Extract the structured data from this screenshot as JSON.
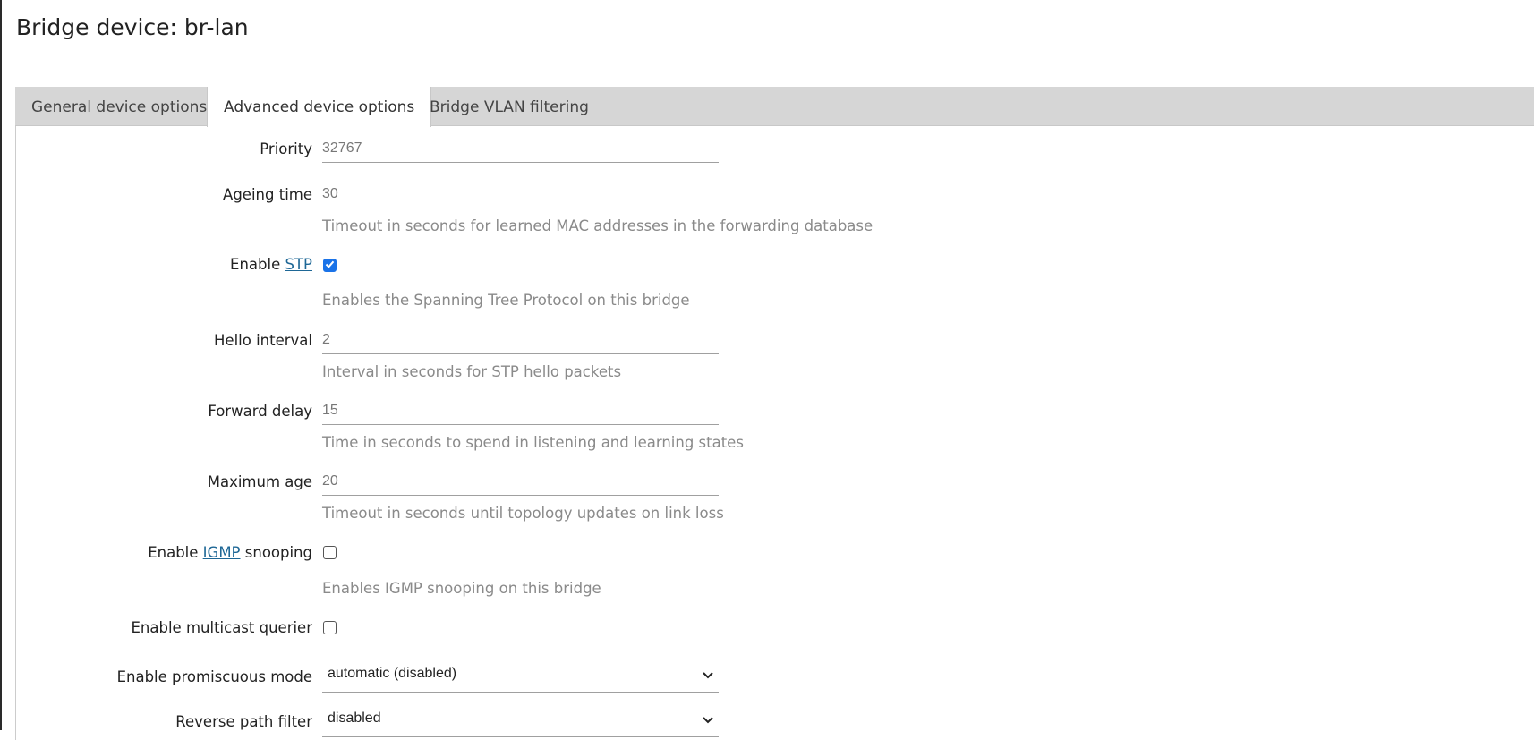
{
  "page": {
    "title": "Bridge device: br-lan"
  },
  "tabs": [
    {
      "label": "General device options",
      "active": false
    },
    {
      "label": "Advanced device options",
      "active": true
    },
    {
      "label": "Bridge VLAN filtering",
      "active": false
    }
  ],
  "form": {
    "priority": {
      "label": "Priority",
      "value": "32767"
    },
    "ageing_time": {
      "label": "Ageing time",
      "value": "30",
      "hint": "Timeout in seconds for learned MAC addresses in the forwarding database"
    },
    "stp": {
      "label_prefix": "Enable ",
      "label_link": "STP",
      "checked": true,
      "hint": "Enables the Spanning Tree Protocol on this bridge"
    },
    "hello_interval": {
      "label": "Hello interval",
      "value": "2",
      "hint": "Interval in seconds for STP hello packets"
    },
    "forward_delay": {
      "label": "Forward delay",
      "value": "15",
      "hint": "Time in seconds to spend in listening and learning states"
    },
    "maximum_age": {
      "label": "Maximum age",
      "value": "20",
      "hint": "Timeout in seconds until topology updates on link loss"
    },
    "igmp": {
      "label_prefix": "Enable ",
      "label_link": "IGMP",
      "label_suffix": " snooping",
      "checked": false,
      "hint": "Enables IGMP snooping on this bridge"
    },
    "multicast_querier": {
      "label": "Enable multicast querier",
      "checked": false
    },
    "promiscuous": {
      "label": "Enable promiscuous mode",
      "value": "automatic (disabled)"
    },
    "reverse_path": {
      "label": "Reverse path filter",
      "value": "disabled"
    }
  },
  "colors": {
    "accent": "#1a73e8",
    "link": "#1e6796",
    "tabbar": "#d6d6d6"
  },
  "icons": {
    "checkmark": "checkmark-icon",
    "dropdown": "chevron-down-icon"
  }
}
